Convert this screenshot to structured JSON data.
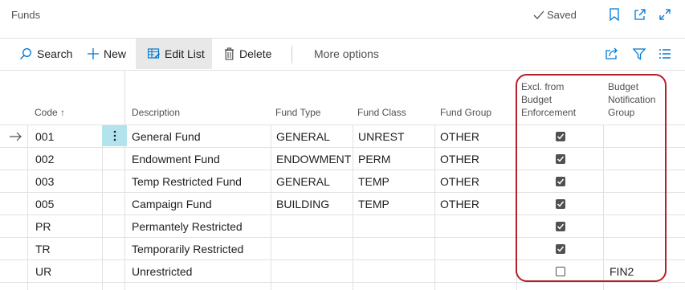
{
  "page": {
    "title": "Funds",
    "status": "Saved"
  },
  "actions": {
    "search": "Search",
    "new": "New",
    "edit_list": "Edit List",
    "delete": "Delete",
    "more_options": "More options"
  },
  "columns": {
    "code": "Code",
    "sort_indicator": "↑",
    "description": "Description",
    "fund_type": "Fund Type",
    "fund_class": "Fund Class",
    "fund_group": "Fund Group",
    "excl_line1": "Excl. from",
    "excl_line2": "Budget",
    "excl_line3": "Enforcement",
    "notif_line1": "Budget",
    "notif_line2": "Notification",
    "notif_line3": "Group"
  },
  "rows": [
    {
      "code": "001",
      "description": "General Fund",
      "fund_type": "GENERAL",
      "fund_class": "UNREST",
      "fund_group": "OTHER",
      "excl": true,
      "notif": ""
    },
    {
      "code": "002",
      "description": "Endowment Fund",
      "fund_type": "ENDOWMENT",
      "fund_class": "PERM",
      "fund_group": "OTHER",
      "excl": true,
      "notif": ""
    },
    {
      "code": "003",
      "description": "Temp Restricted Fund",
      "fund_type": "GENERAL",
      "fund_class": "TEMP",
      "fund_group": "OTHER",
      "excl": true,
      "notif": ""
    },
    {
      "code": "005",
      "description": "Campaign Fund",
      "fund_type": "BUILDING",
      "fund_class": "TEMP",
      "fund_group": "OTHER",
      "excl": true,
      "notif": ""
    },
    {
      "code": "PR",
      "description": "Permantely Restricted",
      "fund_type": "",
      "fund_class": "",
      "fund_group": "",
      "excl": true,
      "notif": ""
    },
    {
      "code": "TR",
      "description": "Temporarily Restricted",
      "fund_type": "",
      "fund_class": "",
      "fund_group": "",
      "excl": true,
      "notif": ""
    },
    {
      "code": "UR",
      "description": "Unrestricted",
      "fund_type": "",
      "fund_class": "",
      "fund_group": "",
      "excl": false,
      "notif": "FIN2"
    }
  ],
  "selected_row": 0,
  "colors": {
    "accent": "#0078d4",
    "highlight": "#b3202a",
    "selected_cell": "#b3e4ee"
  },
  "icons": [
    "checkmark-icon",
    "bookmark-icon",
    "open-in-new-icon",
    "expand-icon",
    "search-icon",
    "plus-icon",
    "edit-list-icon",
    "trash-icon",
    "share-icon",
    "filter-icon",
    "list-view-icon",
    "row-arrow-icon",
    "more-dots-icon"
  ]
}
